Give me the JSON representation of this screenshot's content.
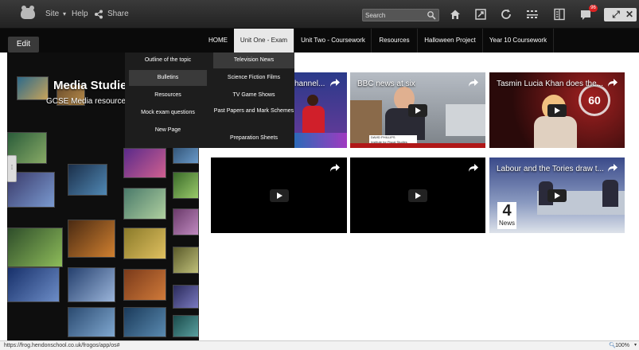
{
  "topbar": {
    "site_label": "Site",
    "help_label": "Help",
    "share_label": "Share",
    "search_placeholder": "Search",
    "notification_count": "96"
  },
  "nav": {
    "edit_label": "Edit",
    "items": [
      "HOME",
      "Unit One - Exam",
      "Unit Two - Coursework",
      "Resources",
      "Halloween Project",
      "Year 10 Coursework"
    ]
  },
  "dropdown": {
    "left_items": [
      "Outline of the topic",
      "Bulletins",
      "Resources",
      "Mock exam questions",
      "New Page"
    ],
    "right_items": [
      "Television News",
      "Science Fiction Films",
      "TV Game Shows",
      "Past Papers and Mark Schemes",
      "Preparation Sheets"
    ]
  },
  "hero": {
    "title": "Media Studies",
    "subtitle": "GCSE Media resources"
  },
  "videos": [
    {
      "title": "hannel..."
    },
    {
      "title": "BBC news at six"
    },
    {
      "title": "Tasmin Lucia Khan does the..."
    },
    {
      "title": ""
    },
    {
      "title": ""
    },
    {
      "title": "Labour and the Tories draw t..."
    }
  ],
  "video_text": {
    "lower_third_name": "DAVID PHILLIPS",
    "lower_third_sub": "Institute for Fiscal Studies",
    "clock_digits": "60",
    "channel_logo": "4",
    "channel_name": "News"
  },
  "status": {
    "url": "https://frog.hendonschool.co.uk/frogos/app/os#",
    "zoom": "100%"
  },
  "colors": {
    "accent_red": "#d22222",
    "nav_active_bg": "#e8e8e8"
  }
}
